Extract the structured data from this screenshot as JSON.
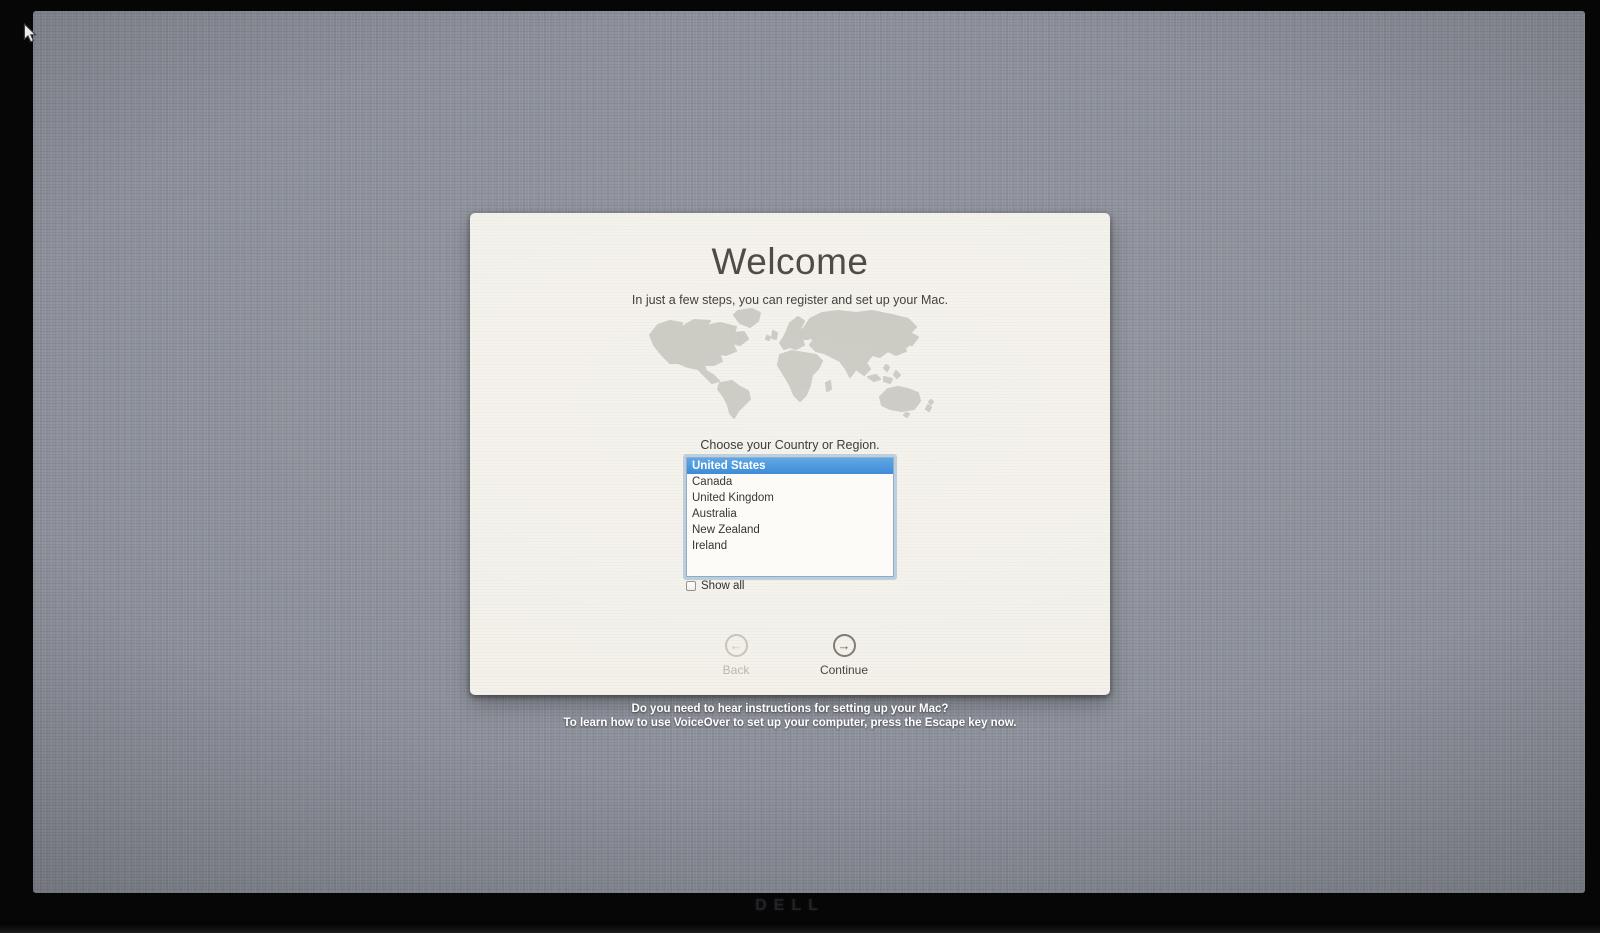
{
  "monitor": {
    "brand_label": "DELL"
  },
  "setup": {
    "title": "Welcome",
    "subtitle": "In just a few steps, you can register and set up your Mac.",
    "country_prompt": "Choose your Country or Region.",
    "countries": [
      {
        "label": "United States",
        "selected": true
      },
      {
        "label": "Canada",
        "selected": false
      },
      {
        "label": "United Kingdom",
        "selected": false
      },
      {
        "label": "Australia",
        "selected": false
      },
      {
        "label": "New Zealand",
        "selected": false
      },
      {
        "label": "Ireland",
        "selected": false
      }
    ],
    "show_all_label": "Show all",
    "show_all_checked": false,
    "back_label": "Back",
    "back_enabled": false,
    "continue_label": "Continue",
    "continue_enabled": true
  },
  "voiceover": {
    "line1": "Do you need to hear instructions for setting up your Mac?",
    "line2": "To learn how to use VoiceOver to set up your computer, press the Escape key now."
  },
  "icons": {
    "back_arrow": "←",
    "continue_arrow": "→"
  },
  "colors": {
    "selection_blue": "#3e93dc",
    "card_background": "#f3f1ea",
    "desktop_gray": "#8d919b",
    "instruction_text": "#ffffff"
  }
}
